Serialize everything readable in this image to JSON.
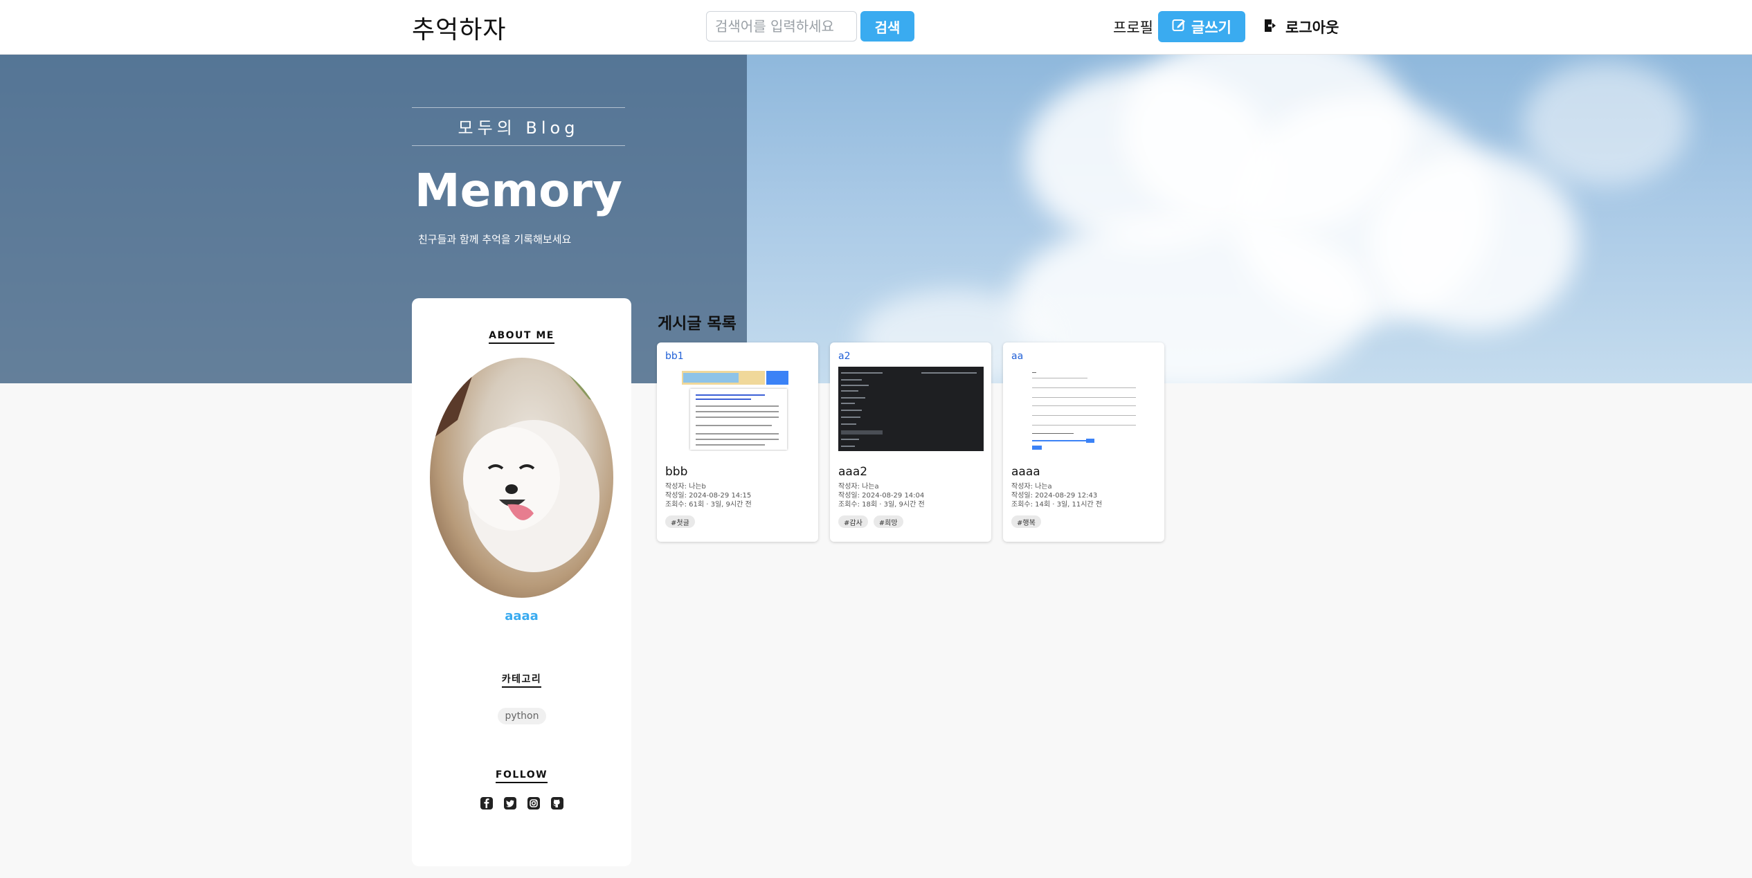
{
  "header": {
    "brand": "추억하자",
    "search_placeholder": "검색어를 입력하세요",
    "search_button": "검색",
    "profile": "프로필",
    "write_button": "글쓰기",
    "logout": "로그아웃",
    "accent_color": "#3aabf0"
  },
  "hero": {
    "subtitle": "모두의 Blog",
    "title": "Memory",
    "description": "친구들과 함께 추억을 기록해보세요"
  },
  "sidebar": {
    "about_heading": "ABOUT ME",
    "username": "aaaa",
    "category_heading": "카테고리",
    "categories": [
      "python"
    ],
    "follow_heading": "FOLLOW",
    "follow_icons": [
      "facebook-icon",
      "twitter-icon",
      "instagram-icon",
      "github-icon"
    ]
  },
  "posts": {
    "heading": "게시글 목록",
    "items": [
      {
        "label": "bb1",
        "title": "bbb",
        "author": "작성자: 나는b",
        "date": "작성일: 2024-08-29 14:15",
        "views": "조회수: 61회 · 3일, 9시간 전",
        "tags": [
          "#첫글"
        ]
      },
      {
        "label": "a2",
        "title": "aaa2",
        "author": "작성자: 나는a",
        "date": "작성일: 2024-08-29 14:04",
        "views": "조회수: 18회 · 3일, 9시간 전",
        "tags": [
          "#감사",
          "#희망"
        ]
      },
      {
        "label": "aa",
        "title": "aaaa",
        "author": "작성자: 나는a",
        "date": "작성일: 2024-08-29 12:43",
        "views": "조회수: 14회 · 3일, 11시간 전",
        "tags": [
          "#행복"
        ]
      }
    ]
  }
}
